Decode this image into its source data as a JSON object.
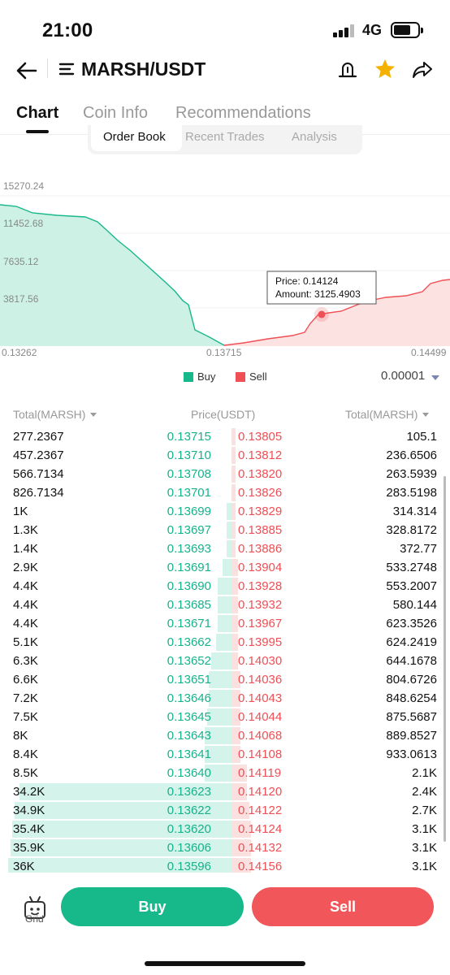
{
  "status": {
    "time": "21:00",
    "network": "4G"
  },
  "nav": {
    "title": "MARSH/USDT"
  },
  "tabs": [
    {
      "label": "Chart"
    },
    {
      "label": "Coin Info"
    },
    {
      "label": "Recommendations"
    }
  ],
  "segments": [
    {
      "label": "Order Book"
    },
    {
      "label": "Recent Trades"
    },
    {
      "label": "Analysis"
    }
  ],
  "depth_chart": {
    "y_ticks": [
      "15270.24",
      "11452.68",
      "7635.12",
      "3817.56"
    ],
    "x_ticks": [
      "0.13262",
      "0.13715",
      "0.14499"
    ],
    "tooltip": {
      "price_label": "Price: 0.14124",
      "amount_label": "Amount: 3125.4903"
    },
    "legend": {
      "buy": "Buy",
      "sell": "Sell"
    },
    "precision": "0.00001",
    "colors": {
      "buy": "#17b88a",
      "sell": "#ef4f55"
    }
  },
  "orderbook": {
    "headers": {
      "left": "Total(MARSH)",
      "mid": "Price(USDT)",
      "right": "Total(MARSH)"
    },
    "rows": [
      {
        "bid_total": "277.2367",
        "bid": "0.13715",
        "ask": "0.13805",
        "ask_total": "105.1",
        "bid_depth": 0.0,
        "ask_depth": 0.02
      },
      {
        "bid_total": "457.2367",
        "bid": "0.13710",
        "ask": "0.13812",
        "ask_total": "236.6506",
        "bid_depth": 0.0,
        "ask_depth": 0.02
      },
      {
        "bid_total": "566.7134",
        "bid": "0.13708",
        "ask": "0.13820",
        "ask_total": "263.5939",
        "bid_depth": 0.0,
        "ask_depth": 0.02
      },
      {
        "bid_total": "826.7134",
        "bid": "0.13701",
        "ask": "0.13826",
        "ask_total": "283.5198",
        "bid_depth": 0.0,
        "ask_depth": 0.02
      },
      {
        "bid_total": "1K",
        "bid": "0.13699",
        "ask": "0.13829",
        "ask_total": "314.314",
        "bid_depth": 0.02,
        "ask_depth": 0.02
      },
      {
        "bid_total": "1.3K",
        "bid": "0.13697",
        "ask": "0.13885",
        "ask_total": "328.8172",
        "bid_depth": 0.02,
        "ask_depth": 0.02
      },
      {
        "bid_total": "1.4K",
        "bid": "0.13693",
        "ask": "0.13886",
        "ask_total": "372.77",
        "bid_depth": 0.02,
        "ask_depth": 0.02
      },
      {
        "bid_total": "2.9K",
        "bid": "0.13691",
        "ask": "0.13904",
        "ask_total": "533.2748",
        "bid_depth": 0.04,
        "ask_depth": 0.03
      },
      {
        "bid_total": "4.4K",
        "bid": "0.13690",
        "ask": "0.13928",
        "ask_total": "553.2007",
        "bid_depth": 0.06,
        "ask_depth": 0.03
      },
      {
        "bid_total": "4.4K",
        "bid": "0.13685",
        "ask": "0.13932",
        "ask_total": "580.144",
        "bid_depth": 0.06,
        "ask_depth": 0.03
      },
      {
        "bid_total": "4.4K",
        "bid": "0.13671",
        "ask": "0.13967",
        "ask_total": "623.3526",
        "bid_depth": 0.06,
        "ask_depth": 0.03
      },
      {
        "bid_total": "5.1K",
        "bid": "0.13662",
        "ask": "0.13995",
        "ask_total": "624.2419",
        "bid_depth": 0.07,
        "ask_depth": 0.03
      },
      {
        "bid_total": "6.3K",
        "bid": "0.13652",
        "ask": "0.14030",
        "ask_total": "644.1678",
        "bid_depth": 0.09,
        "ask_depth": 0.03
      },
      {
        "bid_total": "6.6K",
        "bid": "0.13651",
        "ask": "0.14036",
        "ask_total": "804.6726",
        "bid_depth": 0.1,
        "ask_depth": 0.04
      },
      {
        "bid_total": "7.2K",
        "bid": "0.13646",
        "ask": "0.14043",
        "ask_total": "848.6254",
        "bid_depth": 0.1,
        "ask_depth": 0.04
      },
      {
        "bid_total": "7.5K",
        "bid": "0.13645",
        "ask": "0.14044",
        "ask_total": "875.5687",
        "bid_depth": 0.11,
        "ask_depth": 0.04
      },
      {
        "bid_total": "8K",
        "bid": "0.13643",
        "ask": "0.14068",
        "ask_total": "889.8527",
        "bid_depth": 0.12,
        "ask_depth": 0.04
      },
      {
        "bid_total": "8.4K",
        "bid": "0.13641",
        "ask": "0.14108",
        "ask_total": "933.0613",
        "bid_depth": 0.12,
        "ask_depth": 0.04
      },
      {
        "bid_total": "8.5K",
        "bid": "0.13640",
        "ask": "0.14119",
        "ask_total": "2.1K",
        "bid_depth": 0.12,
        "ask_depth": 0.07
      },
      {
        "bid_total": "34.2K",
        "bid": "0.13623",
        "ask": "0.14120",
        "ask_total": "2.4K",
        "bid_depth": 0.95,
        "ask_depth": 0.07
      },
      {
        "bid_total": "34.9K",
        "bid": "0.13622",
        "ask": "0.14122",
        "ask_total": "2.7K",
        "bid_depth": 0.97,
        "ask_depth": 0.08
      },
      {
        "bid_total": "35.4K",
        "bid": "0.13620",
        "ask": "0.14124",
        "ask_total": "3.1K",
        "bid_depth": 0.98,
        "ask_depth": 0.09
      },
      {
        "bid_total": "35.9K",
        "bid": "0.13606",
        "ask": "0.14132",
        "ask_total": "3.1K",
        "bid_depth": 0.99,
        "ask_depth": 0.09
      },
      {
        "bid_total": "36K",
        "bid": "0.13596",
        "ask": "0.14156",
        "ask_total": "3.1K",
        "bid_depth": 1.0,
        "ask_depth": 0.09
      }
    ]
  },
  "bottom": {
    "grid_label": "Grid",
    "buy_label": "Buy",
    "sell_label": "Sell"
  }
}
